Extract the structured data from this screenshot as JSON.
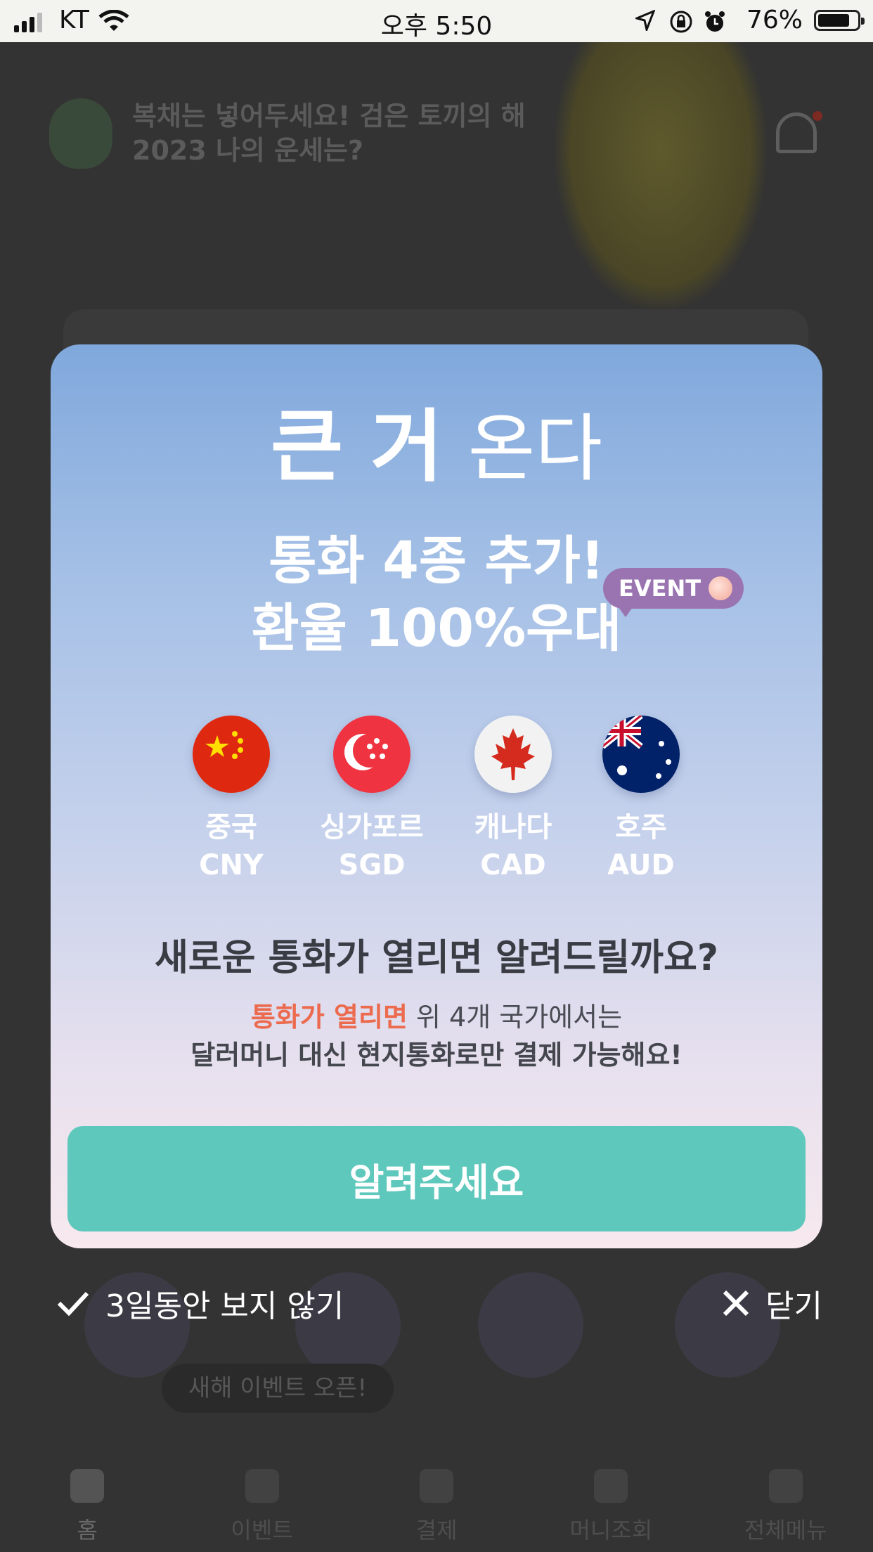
{
  "status_bar": {
    "carrier": "KT",
    "time": "오후 5:50",
    "battery": "76%"
  },
  "background": {
    "banner_title_line1": "복채는 넣어두세요! 검은 토끼의 해",
    "banner_title_line2": "2023 나의 운세는?",
    "event_chip": "새해 이벤트 오픈!",
    "tabs": [
      {
        "label": "홈",
        "icon": "home-icon"
      },
      {
        "label": "이벤트",
        "icon": "star-icon"
      },
      {
        "label": "결제",
        "icon": "scan-icon"
      },
      {
        "label": "머니조회",
        "icon": "coin-icon"
      },
      {
        "label": "전체메뉴",
        "icon": "grid-icon"
      }
    ]
  },
  "modal": {
    "headline_bold": "큰 거",
    "headline_light": "온다",
    "sub_line1": "통화 4종 추가!",
    "sub_line2": "환율 100%우대",
    "event_badge": "EVENT",
    "currencies": [
      {
        "name": "중국",
        "code": "CNY",
        "flag": "china-flag-icon"
      },
      {
        "name": "싱가포르",
        "code": "SGD",
        "flag": "singapore-flag-icon"
      },
      {
        "name": "캐나다",
        "code": "CAD",
        "flag": "canada-flag-icon"
      },
      {
        "name": "호주",
        "code": "AUD",
        "flag": "australia-flag-icon"
      }
    ],
    "question": "새로운 통화가 열리면 알려드릴까요?",
    "note_highlight": "통화가 열리면",
    "note_rest": " 위 4개 국가에서는",
    "note_line2": "달러머니 대신 현지통화로만 결제 가능해요!",
    "cta_label": "알려주세요"
  },
  "footer": {
    "dont_show_label": "3일동안 보지 않기",
    "close_label": "닫기"
  },
  "colors": {
    "cta": "#5fc8bc",
    "highlight": "#ec6a4d",
    "event_badge": "#9a74b0"
  }
}
